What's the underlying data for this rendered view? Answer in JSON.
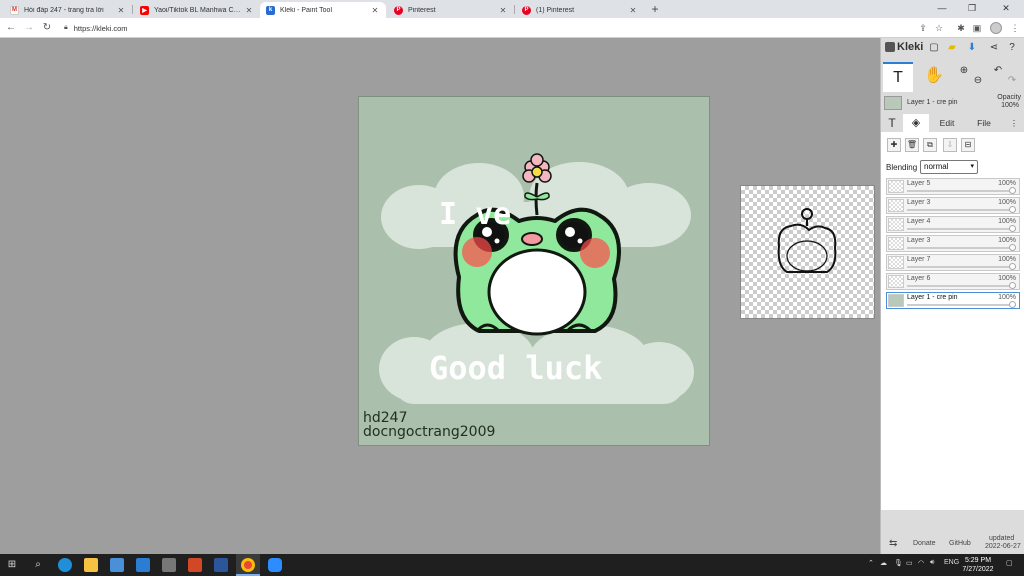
{
  "browser": {
    "tabs": [
      {
        "title": "Hỏi đáp 247 - trang tra lời",
        "icon": "gmail-icon",
        "color": "#ffffff"
      },
      {
        "title": "Yaoi/Tiktok BL Manhwa Compilati",
        "icon": "youtube-icon",
        "color": "#ff0000"
      },
      {
        "title": "Kleki - Paint Tool",
        "icon": "kleki-icon",
        "color": "#2a6bd1"
      },
      {
        "title": "Pinterest",
        "icon": "pinterest-icon",
        "color": "#e60023"
      },
      {
        "title": "(1) Pinterest",
        "icon": "pinterest-icon",
        "color": "#e60023"
      }
    ],
    "url": "https://kleki.com"
  },
  "artwork": {
    "top_text": "I  ve",
    "bottom_text": "Good  luck",
    "signature_line1": "hd247",
    "signature_line2": "docngoctrang2009",
    "background_color": "#abbfad",
    "frog_color": "#8fe89c"
  },
  "panel": {
    "logo": "Kleki",
    "current_layer": "Layer 1 - cre pin",
    "opacity_label": "Opacity",
    "opacity_value": "100%",
    "tabs": [
      "Edit",
      "File"
    ],
    "blending_label": "Blending",
    "blending_value": "normal",
    "layers": [
      {
        "name": "Layer 5",
        "opacity": "100%",
        "selected": false
      },
      {
        "name": "Layer 3",
        "opacity": "100%",
        "selected": false
      },
      {
        "name": "Layer 4",
        "opacity": "100%",
        "selected": false
      },
      {
        "name": "Layer 3",
        "opacity": "100%",
        "selected": false
      },
      {
        "name": "Layer 7",
        "opacity": "100%",
        "selected": false
      },
      {
        "name": "Layer 6",
        "opacity": "100%",
        "selected": false
      },
      {
        "name": "Layer 1 - cre pin",
        "opacity": "100%",
        "selected": true
      }
    ],
    "footer": {
      "donate": "Donate",
      "github": "GitHub",
      "updated_label": "updated",
      "updated_date": "2022-06-27"
    }
  },
  "taskbar": {
    "language": "ENG",
    "time": "5:29 PM",
    "date": "7/27/2022"
  }
}
